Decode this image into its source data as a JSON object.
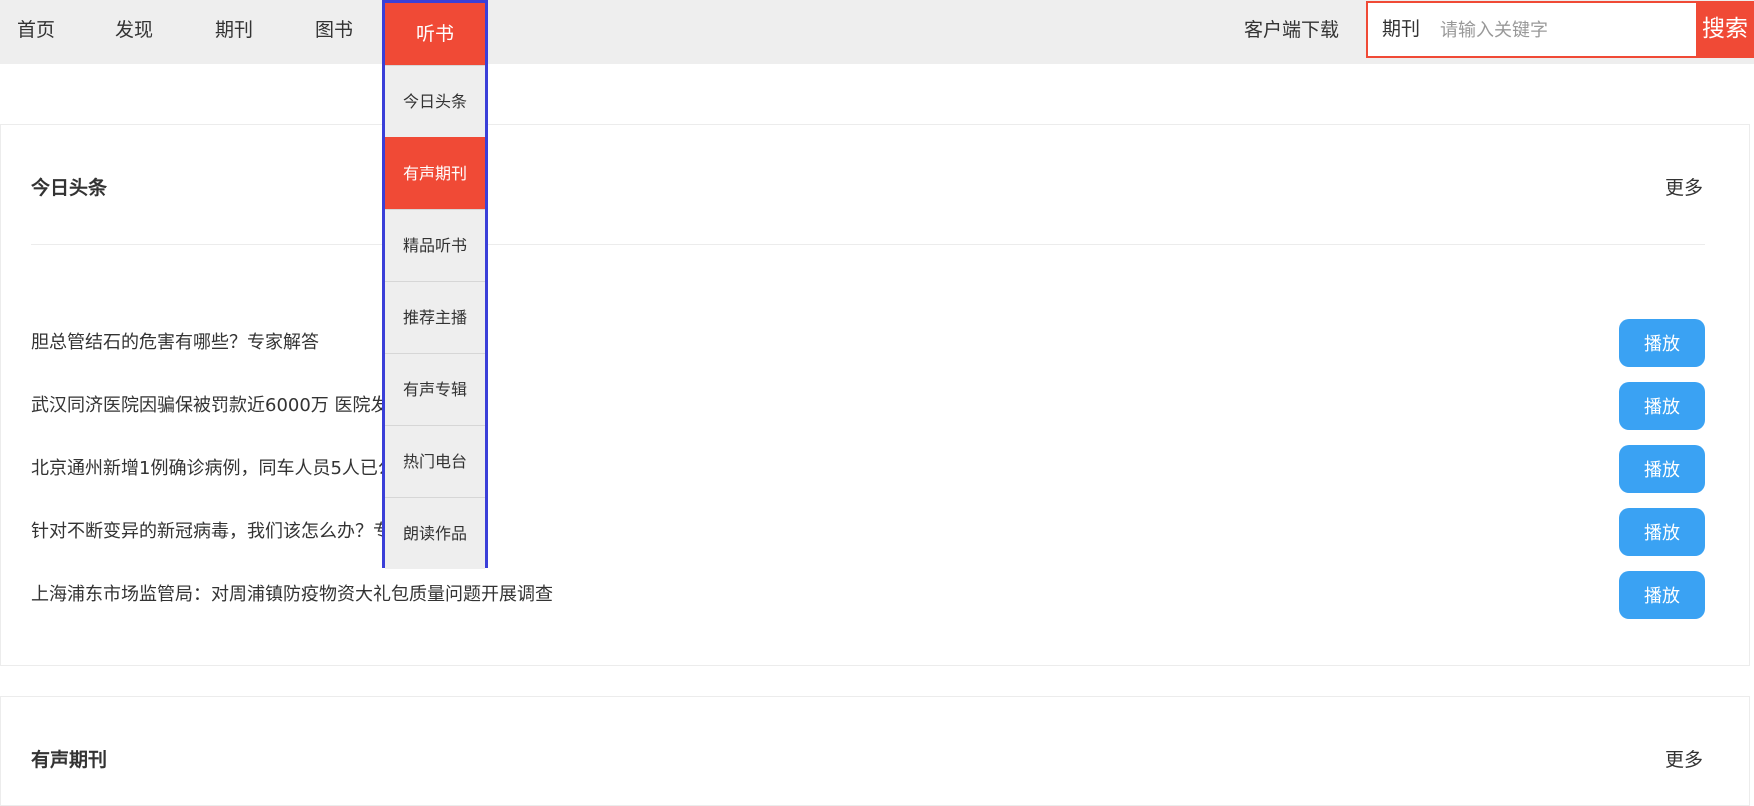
{
  "nav": {
    "items": [
      {
        "label": "首页"
      },
      {
        "label": "发现"
      },
      {
        "label": "期刊"
      },
      {
        "label": "图书"
      },
      {
        "label": "听书",
        "active": true
      }
    ],
    "client_download": "客户端下载"
  },
  "search": {
    "category": "期刊",
    "placeholder": "请输入关键字",
    "button": "搜索"
  },
  "dropdown": {
    "header": "听书",
    "items": [
      {
        "label": "今日头条"
      },
      {
        "label": "有声期刊",
        "active": true
      },
      {
        "label": "精品听书"
      },
      {
        "label": "推荐主播"
      },
      {
        "label": "有声专辑"
      },
      {
        "label": "热门电台"
      },
      {
        "label": "朗读作品"
      }
    ]
  },
  "sections": [
    {
      "title": "今日头条",
      "more": "更多",
      "items": [
        {
          "title": "胆总管结石的危害有哪些？专家解答",
          "play": "播放"
        },
        {
          "title": "武汉同济医院因骗保被罚款近6000万 医院发布情况通报",
          "play": "播放"
        },
        {
          "title": "北京通州新增1例确诊病例，同车人员5人已公布",
          "play": "播放"
        },
        {
          "title": "针对不断变异的新冠病毒，我们该怎么办？专家做出提示",
          "play": "播放"
        },
        {
          "title": "上海浦东市场监管局：对周浦镇防疫物资大礼包质量问题开展调查",
          "play": "播放"
        }
      ]
    },
    {
      "title": "有声期刊",
      "more": "更多"
    }
  ],
  "colors": {
    "accent": "#f04a36",
    "play_button": "#3aa2f3",
    "dropdown_border": "#3a3fd8",
    "nav_bg": "#eeeeee"
  }
}
